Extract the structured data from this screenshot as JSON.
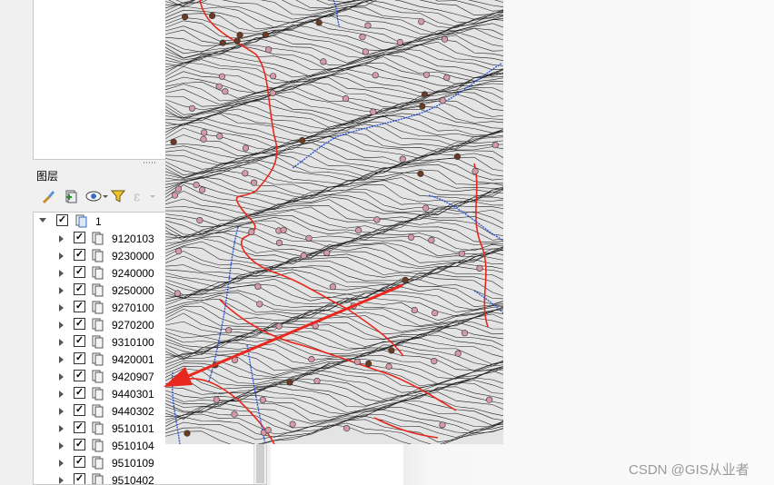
{
  "layers_panel": {
    "title": "图层",
    "group": {
      "name": "1",
      "checked": true,
      "expanded": true
    },
    "layers": [
      {
        "name": "9120103",
        "checked": true
      },
      {
        "name": "9230000",
        "checked": true
      },
      {
        "name": "9240000",
        "checked": true
      },
      {
        "name": "9250000",
        "checked": true
      },
      {
        "name": "9270100",
        "checked": true
      },
      {
        "name": "9270200",
        "checked": true
      },
      {
        "name": "9310100",
        "checked": true
      },
      {
        "name": "9420001",
        "checked": true
      },
      {
        "name": "9420907",
        "checked": true
      },
      {
        "name": "9440301",
        "checked": true
      },
      {
        "name": "9440302",
        "checked": true
      },
      {
        "name": "9510101",
        "checked": true
      },
      {
        "name": "9510104",
        "checked": true
      },
      {
        "name": "9510109",
        "checked": true
      },
      {
        "name": "9510402",
        "checked": true
      }
    ],
    "toolbar_icons": [
      "style-brush-icon",
      "add-group-icon",
      "visibility-eye-icon",
      "filter-icon",
      "expression-filter-icon",
      "expand-all-icon",
      "collapse-all-icon",
      "remove-layer-icon"
    ]
  },
  "watermark": "CSDN @GIS从业者",
  "colors": {
    "arrow": "#e8281e",
    "contour": "#1a1a1a",
    "road": "#e8281e",
    "river": "#2a55d4",
    "point_pink": "#d49aa8",
    "point_brown": "#6b3a22"
  }
}
